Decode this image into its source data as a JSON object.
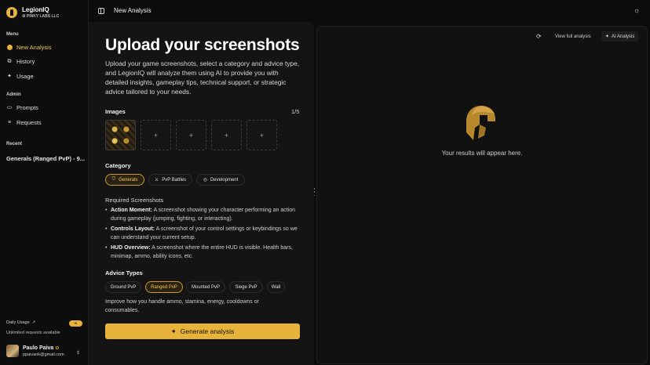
{
  "brand": {
    "name": "LegionIQ",
    "org": "PINKY LABS LLC"
  },
  "sidebar": {
    "menu_label": "Menu",
    "menu_items": [
      {
        "label": "New Analysis",
        "icon": "dot-icon",
        "active": true
      },
      {
        "label": "History",
        "icon": "history-icon"
      },
      {
        "label": "Usage",
        "icon": "sparkles-icon"
      }
    ],
    "admin_label": "Admin",
    "admin_items": [
      {
        "label": "Prompts",
        "icon": "chat-icon"
      },
      {
        "label": "Requests",
        "icon": "list-icon"
      }
    ],
    "recent_label": "Recent",
    "recent_item": "Generals (Ranged PvP) - 9...",
    "usage": {
      "label": "Daily Usage",
      "badge": "∞",
      "sub": "Unlimited requests available"
    },
    "user": {
      "name": "Paulo Paiva",
      "email": "ppaivank@gmail.com"
    }
  },
  "topbar": {
    "title": "New Analysis"
  },
  "main": {
    "heading": "Upload your screenshots",
    "intro": "Upload your game screenshots, select a category and advice type, and LegionIQ will analyze them using AI to provide you with detailed insights, gameplay tips, technical support, or strategic advice tailored to your needs.",
    "images_label": "Images",
    "images_count": "1/5",
    "add_glyph": "+",
    "category_label": "Category",
    "categories": [
      "Generals",
      "PvP Battles",
      "Development"
    ],
    "selected_category": "Generals",
    "required_label": "Required Screenshots",
    "required": [
      {
        "title": "Action Moment:",
        "desc": "A screenshot showing your character performing an action during gameplay (jumping, fighting, or interacting)."
      },
      {
        "title": "Controls Layout:",
        "desc": "A screenshot of your control settings or keybindings so we can understand your current setup."
      },
      {
        "title": "HUD Overview:",
        "desc": "A screenshot where the entire HUD is visible. Health bars, minimap, ammo, ability icons, etc."
      }
    ],
    "advice_label": "Advice Types",
    "advice_types": [
      "Ground PvP",
      "Ranged PvP",
      "Mounted PvP",
      "Siege PvP",
      "Wall"
    ],
    "selected_advice": "Ranged PvP",
    "advice_desc": "Improve how you handle ammo, stamina, energy, cooldowns or consumables.",
    "generate_label": "Generate analysis"
  },
  "results": {
    "view_full": "View full analysis",
    "ai_label": "AI Analysis",
    "placeholder": "Your results will appear here."
  },
  "colors": {
    "accent": "#e7b33a",
    "background": "#0b0b0b",
    "panel": "#141414"
  }
}
